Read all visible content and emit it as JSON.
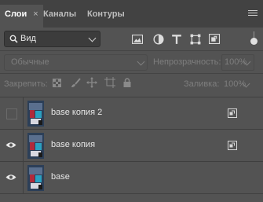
{
  "tabs": [
    {
      "label": "Слои",
      "close": "×"
    },
    {
      "label": "Каналы"
    },
    {
      "label": "Контуры"
    }
  ],
  "filter": {
    "label": "Вид",
    "icons": [
      "image-filter-icon",
      "adjustment-filter-icon",
      "type-filter-icon",
      "shape-filter-icon",
      "smart-object-filter-icon"
    ]
  },
  "blend": {
    "mode": "Обычные",
    "opacity_label": "Непрозрачность:",
    "opacity_value": "100%"
  },
  "lock": {
    "label": "Закрепить:",
    "fill_label": "Заливка:",
    "fill_value": "100%"
  },
  "layers": [
    {
      "name": "base копия 2",
      "visible": false,
      "smart_object": true
    },
    {
      "name": "base копия",
      "visible": true,
      "smart_object": true
    },
    {
      "name": "base",
      "visible": true,
      "smart_object": false
    }
  ]
}
